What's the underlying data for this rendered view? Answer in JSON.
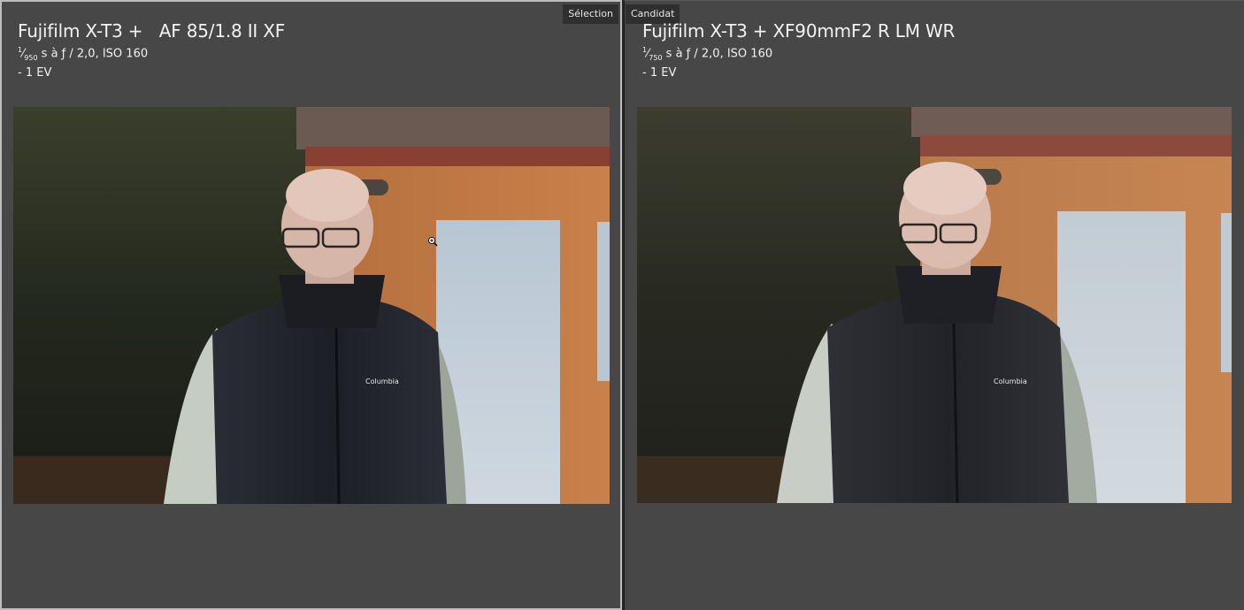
{
  "left_pane": {
    "badge": "Sélection",
    "title": "Fujifilm X-T3 +   AF 85/1.8 II XF",
    "shutter_numerator": "1",
    "shutter_denominator": "950",
    "exposure_rest": " s à ƒ / 2,0, ISO 160",
    "ev": "- 1 EV",
    "photo_label": "portrait-photo",
    "jacket_logo": "Columbia"
  },
  "right_pane": {
    "badge": "Candidat",
    "title": "Fujifilm X-T3 + XF90mmF2 R LM WR",
    "shutter_numerator": "1",
    "shutter_denominator": "750",
    "exposure_rest": " s à ƒ / 2,0, ISO 160",
    "ev": "- 1 EV",
    "photo_label": "portrait-photo",
    "jacket_logo": "Columbia"
  },
  "icons": {
    "zoom_cursor": "zoom-in-cursor-icon"
  },
  "colors": {
    "pane_bg": "#474747",
    "selected_border": "#bdbdbd",
    "text": "#f2f2f2",
    "badge_bg": "#2f2f2f"
  }
}
